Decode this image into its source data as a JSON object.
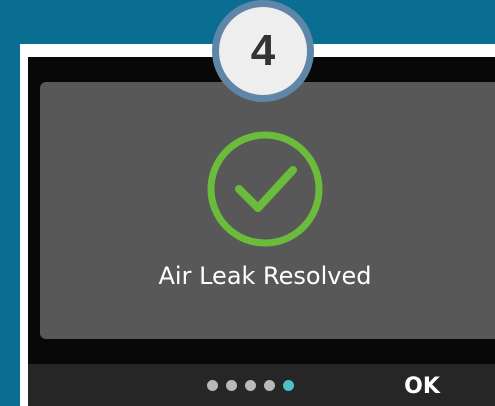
{
  "step": {
    "number": "4"
  },
  "status": {
    "message": "Air Leak Resolved",
    "icon": "checkmark-circle-icon"
  },
  "pagination": {
    "total": 5,
    "current": 5
  },
  "buttons": {
    "ok_label": "OK"
  },
  "colors": {
    "background": "#0a6e93",
    "panel": "#585858",
    "success": "#6cbc3c",
    "active_dot": "#4fc1c4",
    "inactive_dot": "#b9b9b9",
    "badge_ring": "#5f86a8"
  }
}
